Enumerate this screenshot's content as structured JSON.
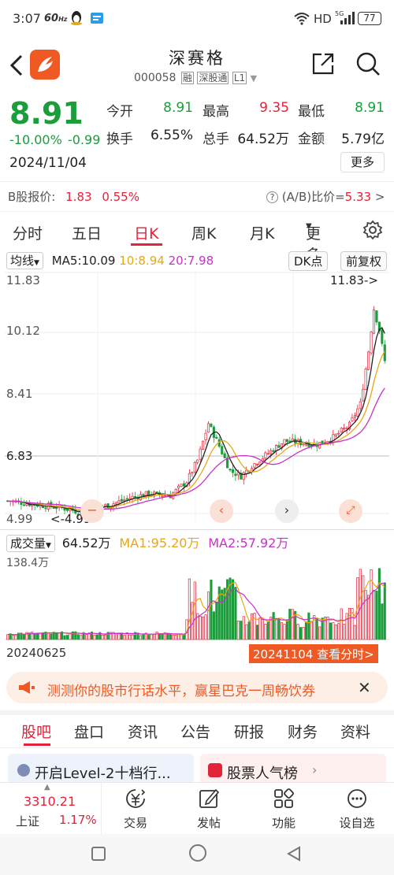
{
  "status_bar": {
    "time": "3:07",
    "net_speed": "60",
    "net_unit": "Hz",
    "hd": "HD",
    "sig": "5G",
    "battery": "77"
  },
  "header": {
    "stock_name": "深赛格",
    "code": "000058",
    "tag_rong": "融",
    "tag_sgt": "深股通",
    "tag_level": "L1"
  },
  "quote": {
    "price": "8.91",
    "change_pct": "-10.00%",
    "change": "-0.99",
    "date": "2024/11/04",
    "open_label": "今开",
    "open": "8.91",
    "high_label": "最高",
    "high": "9.35",
    "low_label": "最低",
    "low": "8.91",
    "turnover_label": "换手",
    "turnover": "6.55%",
    "volume_label": "总手",
    "volume": "64.52万",
    "amount_label": "金额",
    "amount": "5.79亿",
    "more_button": "更多"
  },
  "b_share": {
    "label": "B股报价:",
    "price": "1.83",
    "pct": "0.55%",
    "ratio_label": "(A/B)比价=",
    "ratio": "5.33",
    "arrow": ">"
  },
  "period_tabs": [
    "分时",
    "五日",
    "日K",
    "周K",
    "月K",
    "更多"
  ],
  "active_period": "日K",
  "ma_bar": {
    "selector": "均线",
    "ma5": "MA5:10.09",
    "ma10": "10:8.94",
    "ma20": "20:7.98",
    "dk_button": "DK点",
    "adjust_button": "前复权"
  },
  "kline": {
    "y_labels": [
      "11.83",
      "10.12",
      "8.41",
      "6.83",
      "4.99"
    ],
    "max_marker": "11.83->",
    "min_marker": "<-4.99",
    "ref_price": "6.83"
  },
  "volume_bar": {
    "selector": "成交量",
    "vol": "64.52万",
    "ma1": "MA1:95.20万",
    "ma2": "MA2:57.92万",
    "max_label": "138.4万"
  },
  "x_axis": {
    "start_date": "20240625",
    "end_date": "20241104",
    "end_action": "查看分时>"
  },
  "banner": {
    "text": "测测你的股市行话水平，赢星巴克一周畅饮券"
  },
  "content_tabs": [
    "股吧",
    "盘口",
    "资讯",
    "公告",
    "研报",
    "财务",
    "资料"
  ],
  "active_content_tab": "股吧",
  "cards": {
    "level2": "开启Level-2十档行...",
    "hot": "股票人气榜"
  },
  "bottom_nav": {
    "index_value": "3310.21",
    "index_name": "上证",
    "index_pct": "1.17%",
    "items": [
      "交易",
      "发帖",
      "功能",
      "设自选"
    ]
  },
  "colors": {
    "up": "#e2233a",
    "down": "#1a9d3a",
    "ma5": "#222222",
    "ma10": "#e6a817",
    "ma20": "#c832c8",
    "accent": "#ef5a24"
  }
}
